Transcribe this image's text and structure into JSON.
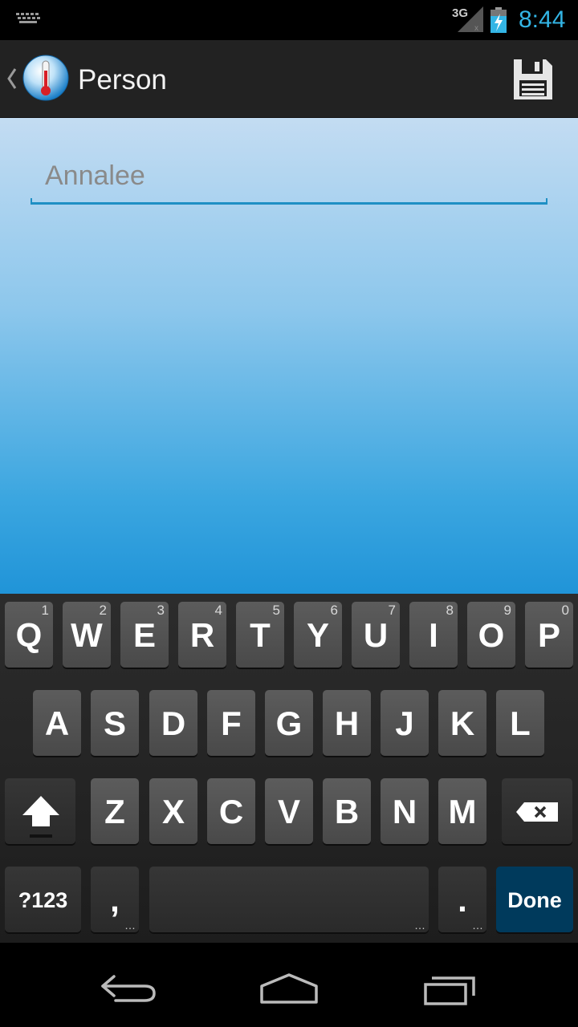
{
  "status_bar": {
    "network": "3G",
    "time": "8:44",
    "clock_color": "#33b5e5"
  },
  "action_bar": {
    "title": "Person",
    "icons": [
      "back-chevron-icon",
      "thermometer-app-icon",
      "save-floppy-icon"
    ]
  },
  "form": {
    "name_placeholder": "Annalee",
    "name_value": "",
    "accent_color": "#1e8fc4"
  },
  "keyboard": {
    "row1": [
      {
        "label": "Q",
        "hint": "1"
      },
      {
        "label": "W",
        "hint": "2"
      },
      {
        "label": "E",
        "hint": "3"
      },
      {
        "label": "R",
        "hint": "4"
      },
      {
        "label": "T",
        "hint": "5"
      },
      {
        "label": "Y",
        "hint": "6"
      },
      {
        "label": "U",
        "hint": "7"
      },
      {
        "label": "I",
        "hint": "8"
      },
      {
        "label": "O",
        "hint": "9"
      },
      {
        "label": "P",
        "hint": "0"
      }
    ],
    "row2": [
      "A",
      "S",
      "D",
      "F",
      "G",
      "H",
      "J",
      "K",
      "L"
    ],
    "row3": [
      "Z",
      "X",
      "C",
      "V",
      "B",
      "N",
      "M"
    ],
    "symbols_label": "?123",
    "comma_label": ",",
    "period_label": ".",
    "done_label": "Done",
    "done_color": "#003a5c"
  },
  "nav_bar": {
    "icons": [
      "back-arrow-icon",
      "home-icon",
      "recent-apps-icon"
    ]
  }
}
